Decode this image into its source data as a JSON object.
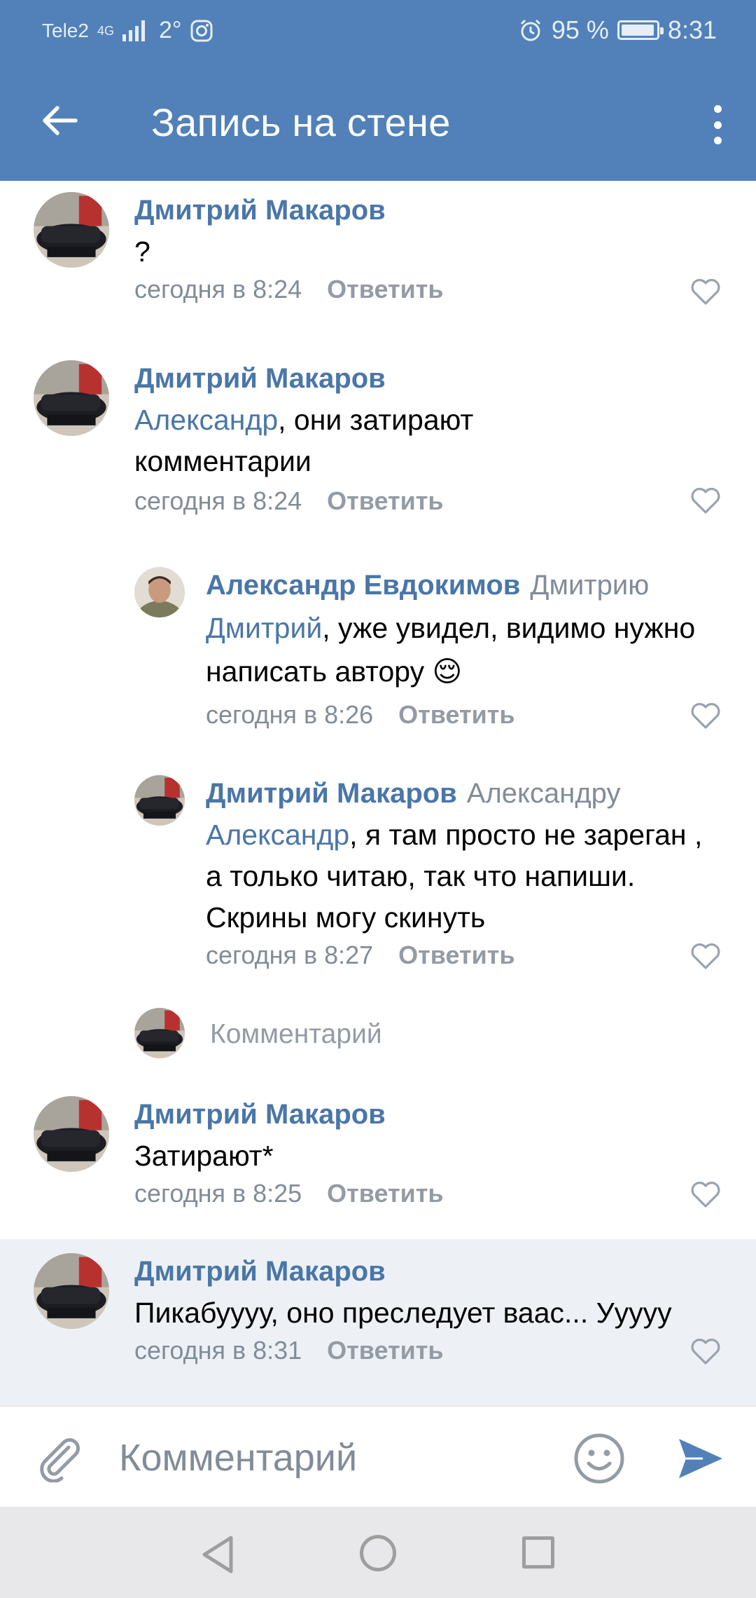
{
  "status_bar": {
    "carrier": "Tele2",
    "network": "4G",
    "temperature": "2°",
    "battery": "95 %",
    "battery_level": 0.95,
    "time": "8:31"
  },
  "app_bar": {
    "title": "Запись на стене",
    "back_icon": "arrow-left-icon",
    "menu_icon": "more-vertical-icon"
  },
  "colors": {
    "accent": "#5181b8",
    "link": "#4a76a8",
    "meta": "#818c99",
    "highlight_bg": "#edf1f6"
  },
  "comments": [
    {
      "author": "Дмитрий Макаров",
      "reply_to": "",
      "mention": "",
      "text": "?",
      "time": "сегодня в 8:24",
      "reply_label": "Ответить"
    },
    {
      "author": "Дмитрий Макаров",
      "reply_to": "",
      "mention": "Александр",
      "text": ", они затирают комментарии",
      "time": "сегодня в 8:24",
      "reply_label": "Ответить"
    },
    {
      "author": "Александр Евдокимов",
      "reply_to": "Дмитрию",
      "mention": "Дмитрий",
      "text": ", уже увидел, видимо нужно написать автору 😌",
      "time": "сегодня в 8:26",
      "reply_label": "Ответить"
    },
    {
      "author": "Дмитрий Макаров",
      "reply_to": "Александру",
      "mention": "Александр",
      "text": ", я там просто не зареган , а только читаю, так что напиши. Скрины могу скинуть",
      "time": "сегодня в 8:27",
      "reply_label": "Ответить"
    },
    {
      "author": "Дмитрий Макаров",
      "reply_to": "",
      "mention": "",
      "text": "Затирают*",
      "time": "сегодня в 8:25",
      "reply_label": "Ответить"
    },
    {
      "author": "Дмитрий Макаров",
      "reply_to": "",
      "mention": "",
      "text": "Пикабуууу, оно преследует ваас... Ууууу",
      "time": "сегодня в 8:31",
      "reply_label": "Ответить"
    }
  ],
  "thread_reply": {
    "placeholder": "Комментарий"
  },
  "composer": {
    "placeholder": "Комментарий",
    "attach_icon": "paperclip-icon",
    "emoji_icon": "smile-icon",
    "send_icon": "send-icon"
  }
}
